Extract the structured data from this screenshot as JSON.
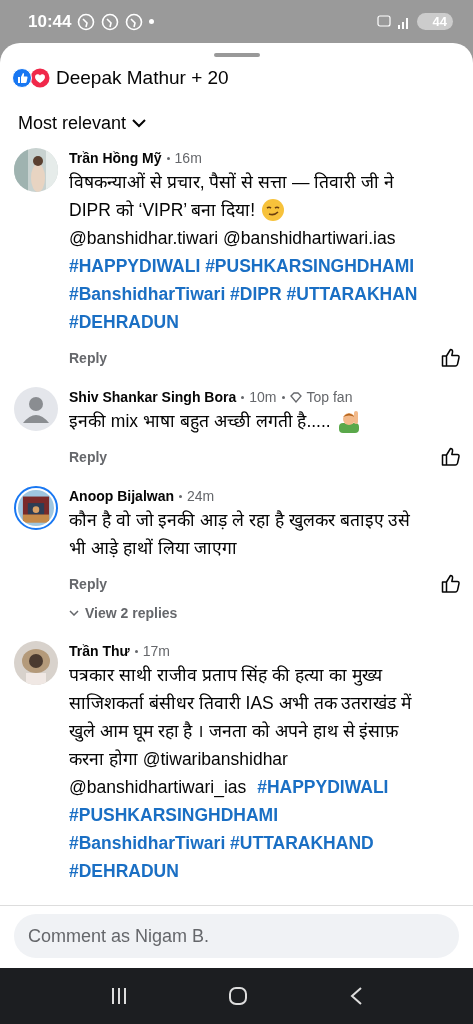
{
  "status_bar": {
    "time": "10:44",
    "battery": "44"
  },
  "reactions": {
    "summary": "Deepak Mathur + 20"
  },
  "sort": {
    "label": "Most relevant"
  },
  "comments": [
    {
      "author": "Trần Hồng Mỹ",
      "time": "16m",
      "avatar": {
        "kind": "picture"
      },
      "story_ring": false,
      "lines": [
        [
          {
            "kind": "text",
            "text": "विषकन्याओं से प्रचार, पैसों से सत्ता — तिवारी जी ने"
          }
        ],
        [
          {
            "kind": "text",
            "text": "DIPR को ‘VIPR’ बना दिया!"
          },
          {
            "kind": "emoji"
          }
        ],
        [
          {
            "kind": "text",
            "text": "@banshidhar.tiwari @banshidhartiwari.ias"
          }
        ],
        [
          {
            "kind": "tag",
            "text": "#HAPPYDIWALI #PUSHKARSINGHDHAMI"
          }
        ],
        [
          {
            "kind": "tag",
            "text": "#BanshidharTiwari #DIPR #UTTARAKHAN"
          }
        ],
        [
          {
            "kind": "tag",
            "text": "#DEHRADUN"
          }
        ]
      ],
      "reply": "Reply"
    },
    {
      "author": "Shiv Shankar Singh Bora",
      "time": "10m",
      "badge": "Top fan",
      "avatar": {
        "kind": "silhouette"
      },
      "story_ring": false,
      "lines": [
        [
          {
            "kind": "text",
            "text": "इनकी mix भाषा बहुत अच्छी लगती है....."
          },
          {
            "kind": "emoji"
          }
        ]
      ],
      "reply": "Reply"
    },
    {
      "author": "Anoop Bijalwan",
      "time": "24m",
      "avatar": {
        "kind": "picture"
      },
      "story_ring": true,
      "lines": [
        [
          {
            "kind": "text",
            "text": "कौन है वो जो इनकी आड़ ले रहा है खुलकर बताइए उसे"
          }
        ],
        [
          {
            "kind": "text",
            "text": "भी आड़े हाथों लिया जाएगा"
          }
        ]
      ],
      "reply": "Reply",
      "view_replies": "View 2 replies"
    },
    {
      "author": "Trần Thư",
      "time": "17m",
      "avatar": {
        "kind": "picture"
      },
      "story_ring": false,
      "lines": [
        [
          {
            "kind": "text",
            "text": "पत्रकार साथी राजीव प्रताप सिंह की हत्या का मुख्य"
          }
        ],
        [
          {
            "kind": "text",
            "text": "साजिशकर्ता बंसीधर तिवारी IAS अभी तक उतराखंड में"
          }
        ],
        [
          {
            "kind": "text",
            "text": "खुले आम घूम रहा है । जनता को अपने हाथ से इंसाफ़"
          }
        ],
        [
          {
            "kind": "text",
            "text": "करना होगा @tiwaribanshidhar"
          }
        ],
        [
          {
            "kind": "text",
            "text": "@banshidhartiwari_ias "
          },
          {
            "kind": "tag",
            "text": "#HAPPYDIWALI"
          }
        ],
        [
          {
            "kind": "tag",
            "text": "#PUSHKARSINGHDHAMI"
          }
        ],
        [
          {
            "kind": "tag",
            "text": "#BanshidharTiwari #UTTARAKHAND"
          }
        ],
        [
          {
            "kind": "tag",
            "text": "#DEHRADUN"
          }
        ]
      ]
    }
  ],
  "composer": {
    "placeholder": "Comment as Nigam B."
  }
}
